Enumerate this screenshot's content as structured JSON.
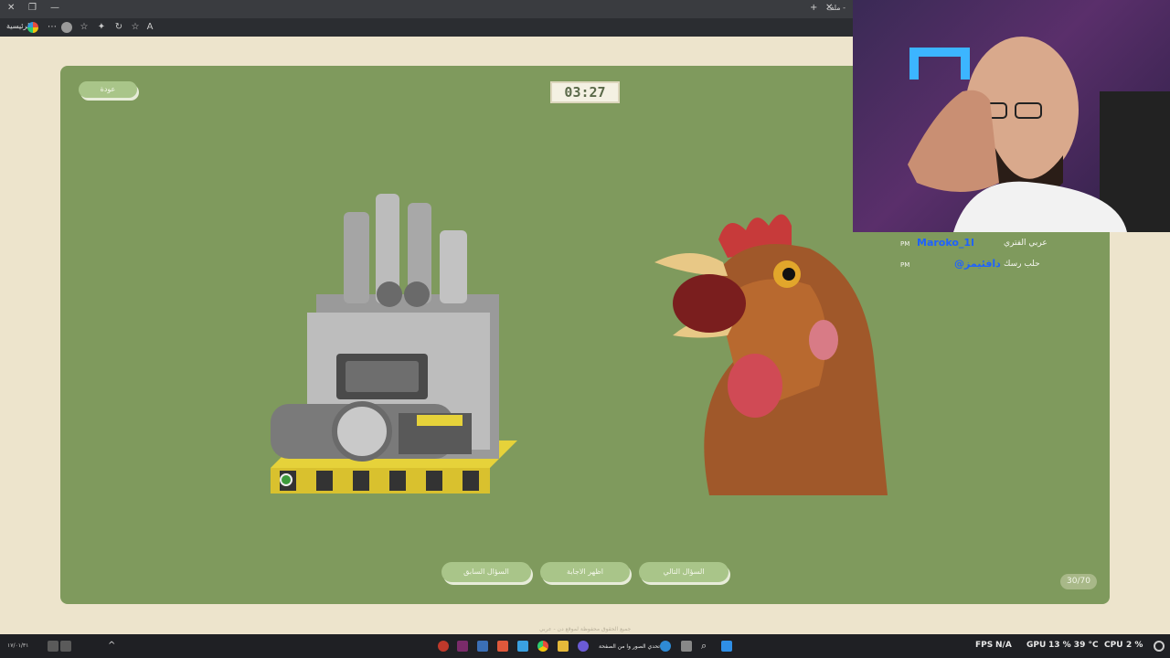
{
  "browser": {
    "home_label": "الرئيسية",
    "tab_label": "ملف -"
  },
  "game": {
    "back_label": "عودة",
    "timer": "03:27",
    "buttons": {
      "prev": "السؤال السابق",
      "show_answer": "اظهر الاجابة",
      "next": "السؤال التالي"
    },
    "counter": "30/70",
    "footer": "جميع الحقوق محفوظة لموقع دن - عربي"
  },
  "chat": {
    "messages": [
      {
        "time": "PM",
        "user": "Maroko_1l",
        "text": "عربي الفتري"
      },
      {
        "time": "PM",
        "user": "@دافئيمز",
        "text": "حلب رسك"
      }
    ]
  },
  "taskbar": {
    "window_title": "تحدي الصور وا من الصفحة",
    "fps_label": "FPS",
    "fps_value": "N/A",
    "gpu_label": "GPU",
    "gpu_value": "13 % 39 °C",
    "cpu_label": "CPU",
    "cpu_value": "2 %",
    "clock": "١٧/٠١/٣١"
  },
  "colors": {
    "panel": "#7f9a5d",
    "page": "#ede4cc",
    "button": "#a9c589",
    "hazard_yellow": "#e6d23a"
  },
  "icons": [
    "close-icon",
    "new-tab-icon",
    "reload-icon",
    "star-icon",
    "profile-icon",
    "menu-icon",
    "search-icon",
    "start-icon"
  ]
}
